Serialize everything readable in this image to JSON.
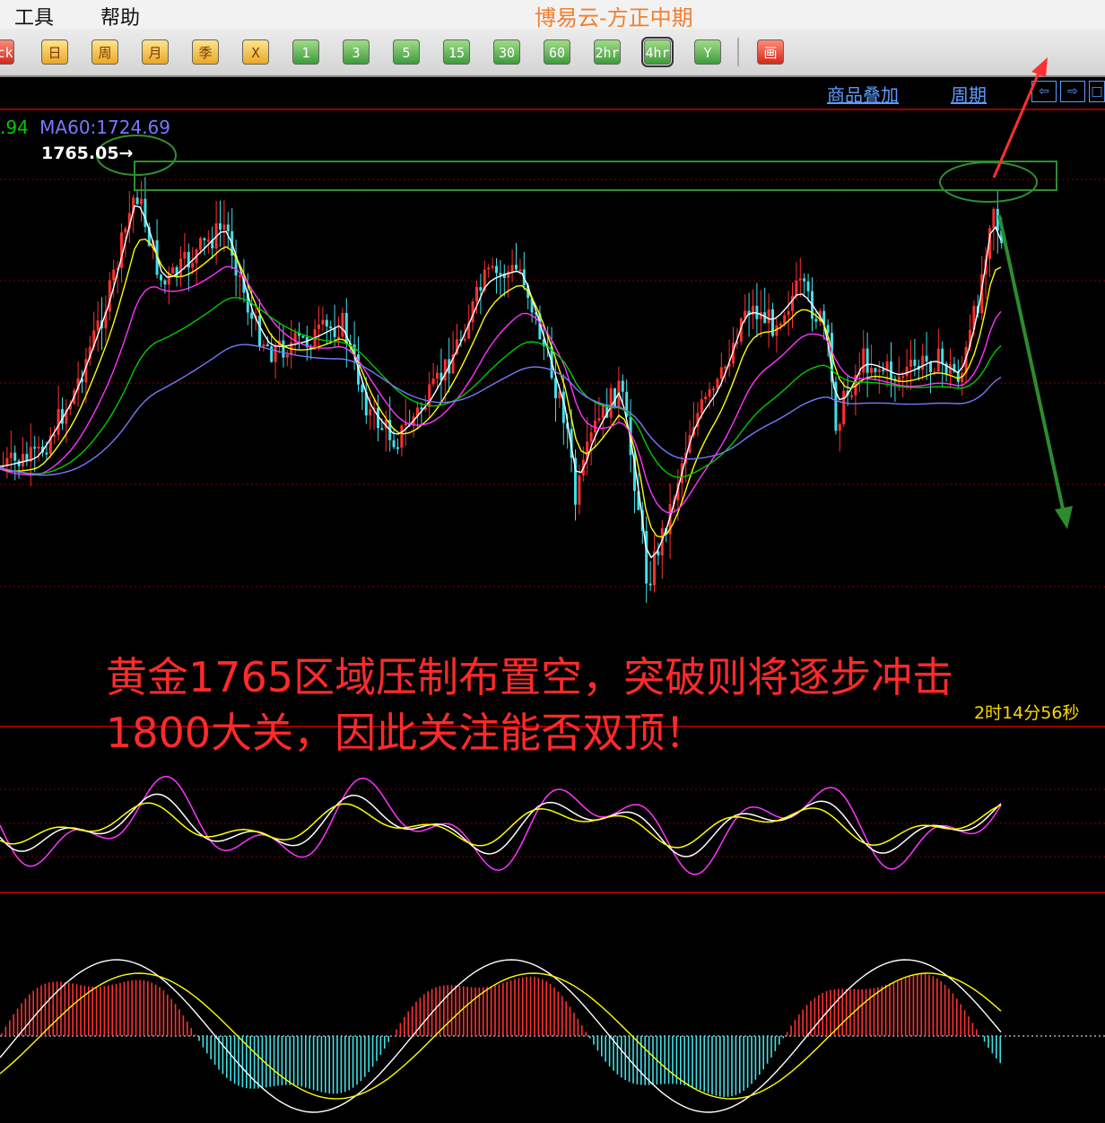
{
  "menu": {
    "tools": "工具",
    "help": "帮助"
  },
  "app_title": "博易云-方正中期",
  "toolbar": {
    "buttons": [
      {
        "label": "ick",
        "style": "red"
      },
      {
        "label": "日",
        "style": "gold"
      },
      {
        "label": "周",
        "style": "gold"
      },
      {
        "label": "月",
        "style": "gold"
      },
      {
        "label": "季",
        "style": "gold"
      },
      {
        "label": "X",
        "style": "gold"
      },
      {
        "label": "1",
        "style": "green"
      },
      {
        "label": "3",
        "style": "green"
      },
      {
        "label": "5",
        "style": "green"
      },
      {
        "label": "15",
        "style": "green"
      },
      {
        "label": "30",
        "style": "green"
      },
      {
        "label": "60",
        "style": "green"
      },
      {
        "label": "2hr",
        "style": "green"
      },
      {
        "label": "4hr",
        "style": "green",
        "selected": true
      },
      {
        "label": "Y",
        "style": "green"
      },
      {
        "label": "画",
        "style": "red"
      }
    ]
  },
  "chart_header": {
    "overlay_link": "商品叠加",
    "period_link": "周期"
  },
  "legend": {
    "ma_prev_tail": ".94",
    "ma60_label": "MA60:1724.69"
  },
  "max_price_label": "1765.05",
  "annotation": {
    "line1": "黄金1765区域压制布置空，突破则将逐步冲击",
    "line2": "1800大关，因此关注能否双顶！"
  },
  "countdown": "2时14分56秒",
  "colors": {
    "up": "#ff3030",
    "down": "#40e0e8",
    "grid": "#8a0000",
    "ma5": "#ffffff",
    "ma10": "#ffff00",
    "ma20": "#ff33ff",
    "ma40": "#00cc00",
    "ma60": "#7878ff",
    "box": "#2f8f2f"
  }
}
